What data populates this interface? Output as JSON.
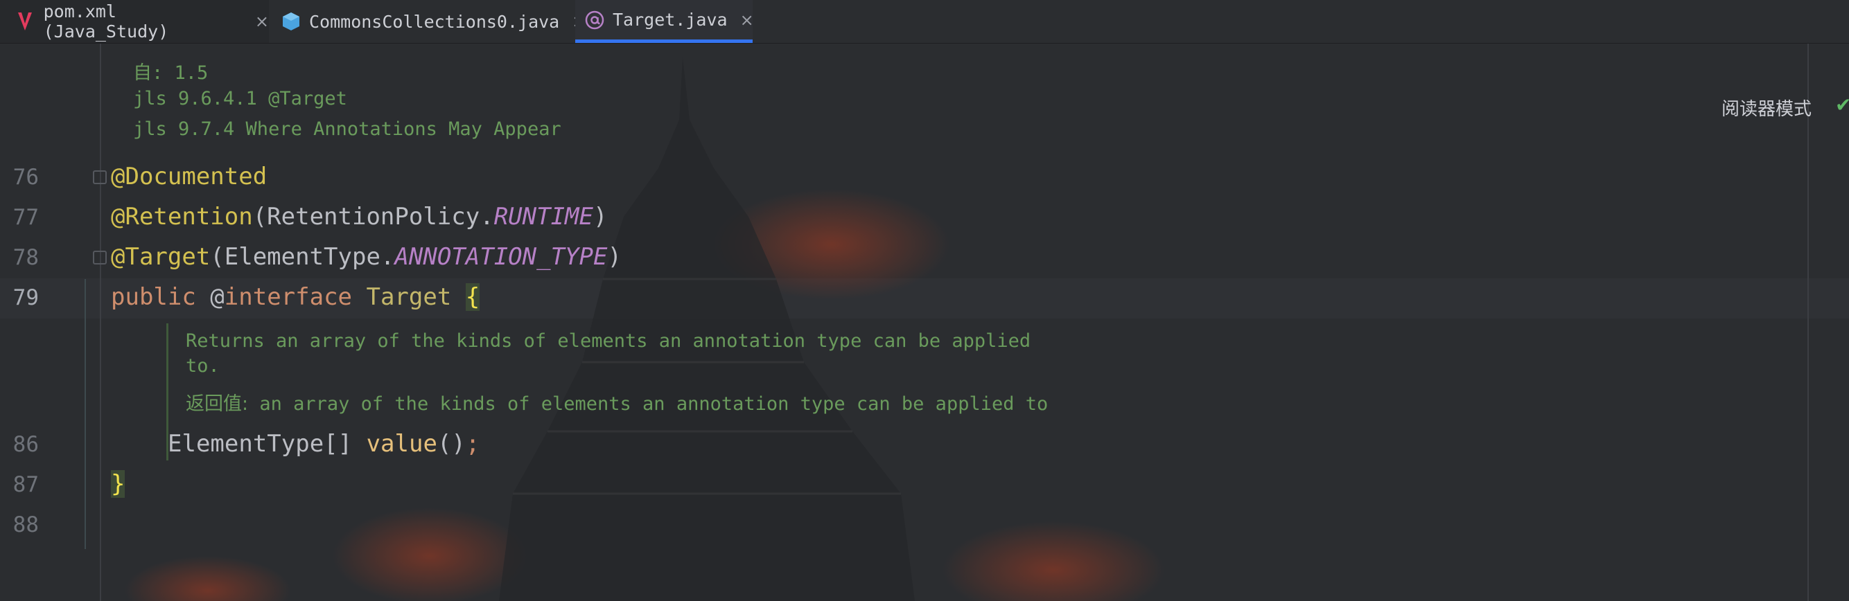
{
  "tabs": [
    {
      "label": "pom.xml (Java_Study)",
      "icon": "maven-icon",
      "close": "×"
    },
    {
      "label": "CommonsCollections0.java",
      "icon": "java-class-icon",
      "close": "×"
    },
    {
      "label": "Target.java",
      "icon": "annotation-icon",
      "close": "×",
      "active": true
    }
  ],
  "toolbar": {
    "reader_mode": "阅读器模式",
    "check_icon": "✔",
    "more_icon": "⋮"
  },
  "doc_top": [
    "自: 1.5",
    "jls 9.6.4.1 @Target",
    "jls 9.7.4 Where Annotations May Appear"
  ],
  "lines": [
    {
      "num": "76",
      "text": "@Documented"
    },
    {
      "num": "77",
      "a": "@Retention",
      "b": "(RetentionPolicy.",
      "c": "RUNTIME",
      "d": ")"
    },
    {
      "num": "78",
      "a": "@Target",
      "b": "(ElementType.",
      "c": "ANNOTATION_TYPE",
      "d": ")"
    },
    {
      "num": "79",
      "kw1": "public ",
      "at": "@",
      "kw2": "interface ",
      "name": "Target ",
      "brace": "{"
    },
    {
      "num": "86",
      "type": "ElementType[] ",
      "method": "value",
      "paren": "()",
      "semi": ";"
    },
    {
      "num": "87",
      "brace": "}"
    },
    {
      "num": "88"
    }
  ],
  "doc_inline": {
    "line1": "Returns an array of the kinds of elements an annotation type can be applied",
    "line2": "to.",
    "returns_label": "返回值:",
    "returns_text": " an array of the kinds of elements an annotation type can be applied to"
  },
  "colors": {
    "background": "#2b2d30",
    "annotation": "#d4c150",
    "keyword": "#cf8e6d",
    "doc": "#6a9b5c",
    "active_tab": "#3574f0"
  }
}
